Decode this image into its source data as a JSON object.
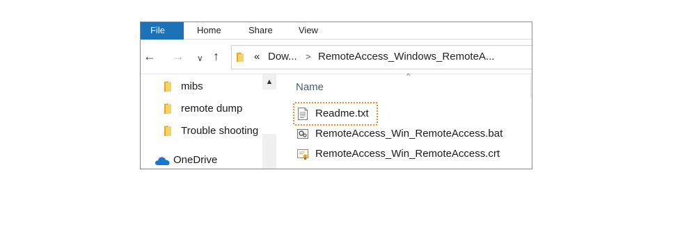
{
  "ribbon": {
    "tabs": [
      {
        "label": "File"
      },
      {
        "label": "Home"
      },
      {
        "label": "Share"
      },
      {
        "label": "View"
      }
    ]
  },
  "nav": {
    "overflow_chevron": "«",
    "path_segments": [
      "Dow...",
      "RemoteAccess_Windows_RemoteA..."
    ],
    "separator": ">"
  },
  "sidebar": {
    "items": [
      {
        "label": "mibs",
        "icon": "folder-icon"
      },
      {
        "label": "remote dump",
        "icon": "folder-icon"
      },
      {
        "label": "Trouble shooting",
        "icon": "folder-icon"
      }
    ],
    "onedrive": {
      "label": "OneDrive",
      "icon": "onedrive-cloud-icon"
    }
  },
  "file_list": {
    "column_header": "Name",
    "files": [
      {
        "name": "Readme.txt",
        "icon": "text-file-icon",
        "highlighted": true
      },
      {
        "name": "RemoteAccess_Win_RemoteAccess.bat",
        "icon": "batch-file-icon",
        "highlighted": false
      },
      {
        "name": "RemoteAccess_Win_RemoteAccess.crt",
        "icon": "certificate-file-icon",
        "highlighted": false
      }
    ]
  },
  "colors": {
    "file_tab": "#1e73b8",
    "folder": "#f5c64a",
    "onedrive": "#1a74d4",
    "highlight": "#ee8a1b"
  }
}
